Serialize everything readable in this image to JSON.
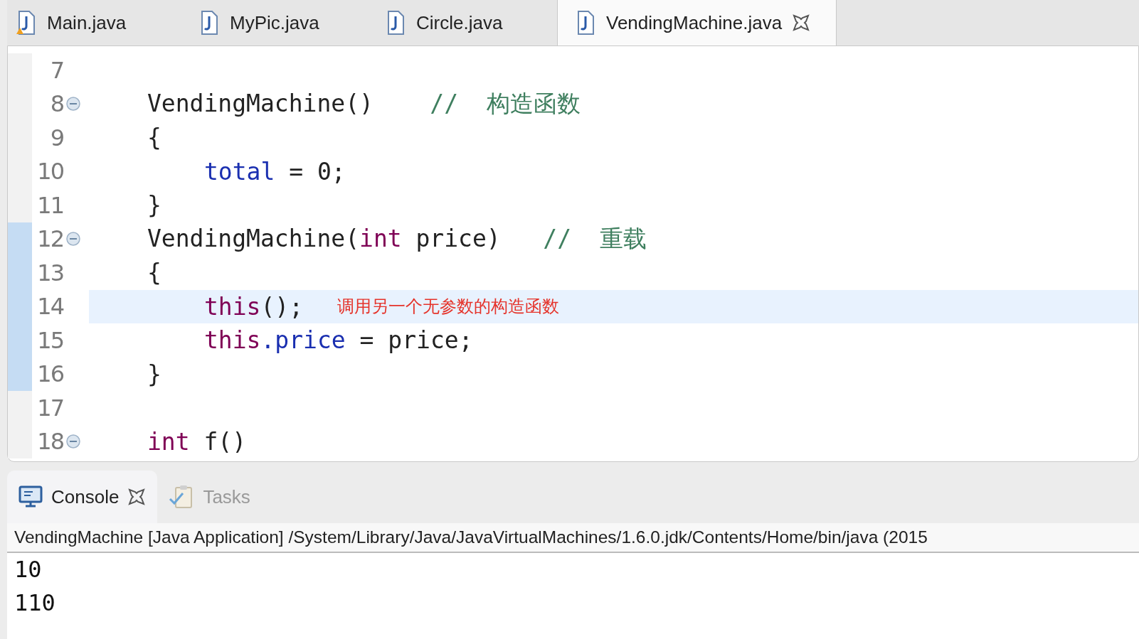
{
  "editor_tabs": [
    {
      "label": "Main.java",
      "selected": false,
      "warning": true
    },
    {
      "label": "MyPic.java",
      "selected": false,
      "warning": false
    },
    {
      "label": "Circle.java",
      "selected": false,
      "warning": false
    },
    {
      "label": "VendingMachine.java",
      "selected": true,
      "warning": false
    }
  ],
  "code_lines": [
    {
      "number": "7",
      "fold": false,
      "current": false,
      "in_range": false
    },
    {
      "number": "8",
      "fold": true,
      "current": false,
      "in_range": false,
      "indented": false,
      "tokens": [
        {
          "kind": "plain",
          "text": "VendingMachine()    "
        },
        {
          "kind": "comment",
          "text": "//  构造函数"
        }
      ]
    },
    {
      "number": "9",
      "fold": false,
      "current": false,
      "in_range": false,
      "indented": false,
      "tokens": [
        {
          "kind": "plain",
          "text": "{"
        }
      ]
    },
    {
      "number": "10",
      "fold": false,
      "current": false,
      "in_range": false,
      "indented": true,
      "tokens": [
        {
          "kind": "field",
          "text": "total"
        },
        {
          "kind": "plain",
          "text": " = 0;"
        }
      ]
    },
    {
      "number": "11",
      "fold": false,
      "current": false,
      "in_range": false,
      "indented": false,
      "tokens": [
        {
          "kind": "plain",
          "text": "}"
        }
      ]
    },
    {
      "number": "12",
      "fold": true,
      "current": false,
      "in_range": true,
      "indented": false,
      "tokens": [
        {
          "kind": "plain",
          "text": "VendingMachine("
        },
        {
          "kind": "keyword",
          "text": "int"
        },
        {
          "kind": "plain",
          "text": " price)   "
        },
        {
          "kind": "comment",
          "text": "//  重载"
        }
      ]
    },
    {
      "number": "13",
      "fold": false,
      "current": false,
      "in_range": true,
      "indented": false,
      "tokens": [
        {
          "kind": "plain",
          "text": "{"
        }
      ]
    },
    {
      "number": "14",
      "fold": false,
      "current": true,
      "in_range": true,
      "indented": true,
      "tokens": [
        {
          "kind": "keyword",
          "text": "this"
        },
        {
          "kind": "plain",
          "text": "();"
        }
      ],
      "note": "调用另一个无参数的构造函数"
    },
    {
      "number": "15",
      "fold": false,
      "current": false,
      "in_range": true,
      "indented": true,
      "tokens": [
        {
          "kind": "keyword",
          "text": "this"
        },
        {
          "kind": "field",
          "text": ".price"
        },
        {
          "kind": "plain",
          "text": " = price;"
        }
      ]
    },
    {
      "number": "16",
      "fold": false,
      "current": false,
      "in_range": true,
      "indented": false,
      "tokens": [
        {
          "kind": "plain",
          "text": "}"
        }
      ]
    },
    {
      "number": "17",
      "fold": false,
      "current": false,
      "in_range": false
    },
    {
      "number": "18",
      "fold": true,
      "current": false,
      "in_range": false,
      "indented": false,
      "tokens": [
        {
          "kind": "keyword",
          "text": "int"
        },
        {
          "kind": "plain",
          "text": " f()"
        }
      ]
    }
  ],
  "console_tabs": [
    {
      "label": "Console",
      "selected": true,
      "kind": "console"
    },
    {
      "label": "Tasks",
      "selected": false,
      "kind": "tasks"
    }
  ],
  "console_header": "VendingMachine [Java Application] /System/Library/Java/JavaVirtualMachines/1.6.0.jdk/Contents/Home/bin/java (2015",
  "console_output": [
    "10",
    "110"
  ]
}
